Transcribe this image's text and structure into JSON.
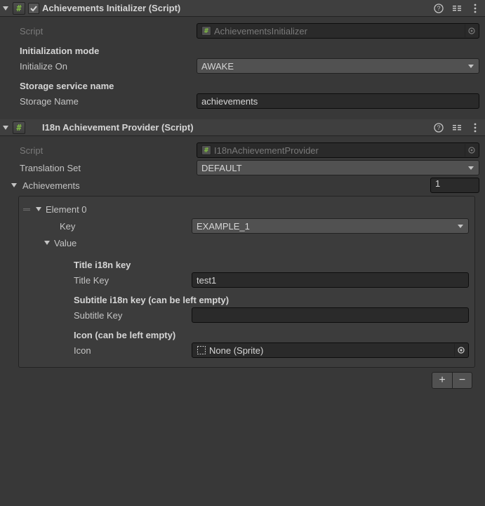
{
  "component1": {
    "title": "Achievements Initializer (Script)",
    "enabled": true,
    "script_label": "Script",
    "script_value": "AchievementsInitializer",
    "init_mode_heading": "Initialization mode",
    "initialize_on_label": "Initialize On",
    "initialize_on_value": "AWAKE",
    "storage_heading": "Storage service name",
    "storage_name_label": "Storage Name",
    "storage_name_value": "achievements"
  },
  "component2": {
    "title": "I18n Achievement Provider (Script)",
    "script_label": "Script",
    "script_value": "I18nAchievementProvider",
    "translation_set_label": "Translation Set",
    "translation_set_value": "DEFAULT",
    "achievements_label": "Achievements",
    "achievements_size": "1",
    "element0": {
      "label": "Element 0",
      "key_label": "Key",
      "key_value": "EXAMPLE_1",
      "value_label": "Value",
      "title_heading": "Title i18n key",
      "title_key_label": "Title Key",
      "title_key_value": "test1",
      "subtitle_heading": "Subtitle i18n key (can be left empty)",
      "subtitle_key_label": "Subtitle Key",
      "subtitle_key_value": "",
      "icon_heading": "Icon (can be left empty)",
      "icon_label": "Icon",
      "icon_value": "None (Sprite)"
    }
  }
}
